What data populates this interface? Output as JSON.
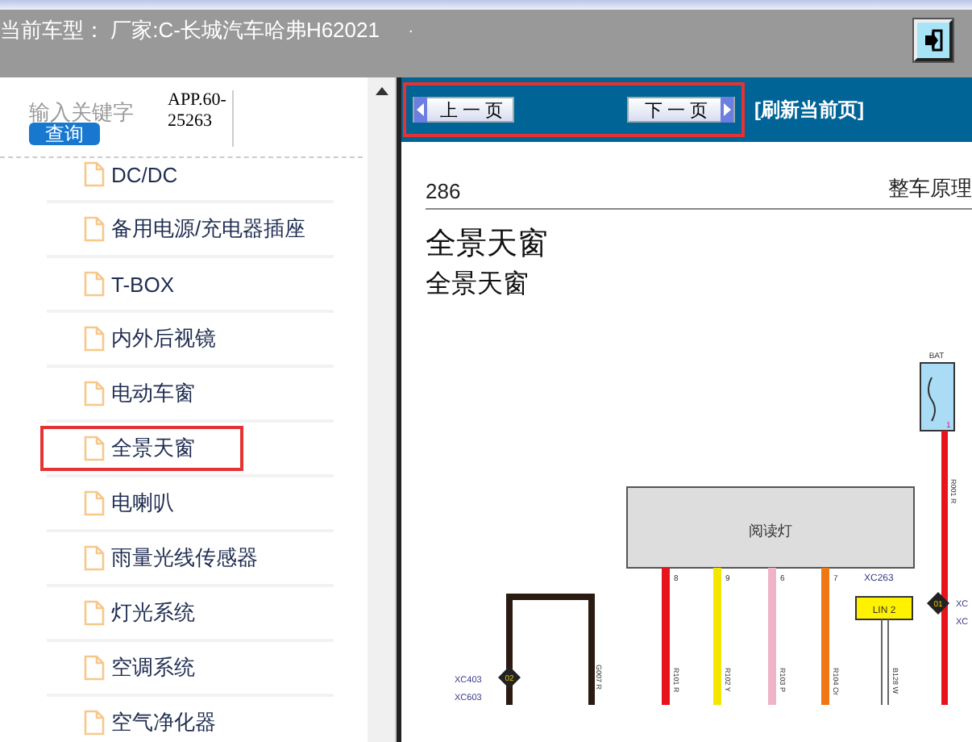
{
  "header": {
    "vehicle": "当前车型： 厂家:C-长城汽车哈弗H62021",
    "dot": "."
  },
  "search": {
    "placeholder": "输入关键字",
    "button": "查询",
    "app_version": "APP.60-25263"
  },
  "sidebar": {
    "items": [
      {
        "label": "DC/DC",
        "selected": false
      },
      {
        "label": "备用电源/充电器插座",
        "selected": false
      },
      {
        "label": "T-BOX",
        "selected": false
      },
      {
        "label": "内外后视镜",
        "selected": false
      },
      {
        "label": "电动车窗",
        "selected": false
      },
      {
        "label": "全景天窗",
        "selected": true
      },
      {
        "label": "电喇叭",
        "selected": false
      },
      {
        "label": "雨量光线传感器",
        "selected": false
      },
      {
        "label": "灯光系统",
        "selected": false
      },
      {
        "label": "空调系统",
        "selected": false
      },
      {
        "label": "空气净化器",
        "selected": false
      }
    ]
  },
  "toolbar": {
    "prev": "上 一 页",
    "next": "下 一 页",
    "refresh": "[刷新当前页]",
    "nav_highlighted": true
  },
  "document": {
    "page_number": "286",
    "section": "整车原理",
    "title": "全景天窗",
    "subtitle": "全景天窗",
    "diagram": {
      "bat": "BAT",
      "fuse_pin": "1",
      "module": "阅读灯",
      "connector": "XC263",
      "lin": "LIN 2",
      "splice_1": "01",
      "splice_2": "02",
      "left_connectors": [
        "XC403",
        "XC603"
      ],
      "right_connectors": [
        "XC",
        "XC"
      ],
      "pins": [
        "8",
        "9",
        "6",
        "7"
      ],
      "wires": [
        "G007 R",
        "R101 R",
        "R102 Y",
        "R103 P",
        "R104 Or",
        "B128 W",
        "R001 R"
      ]
    }
  }
}
